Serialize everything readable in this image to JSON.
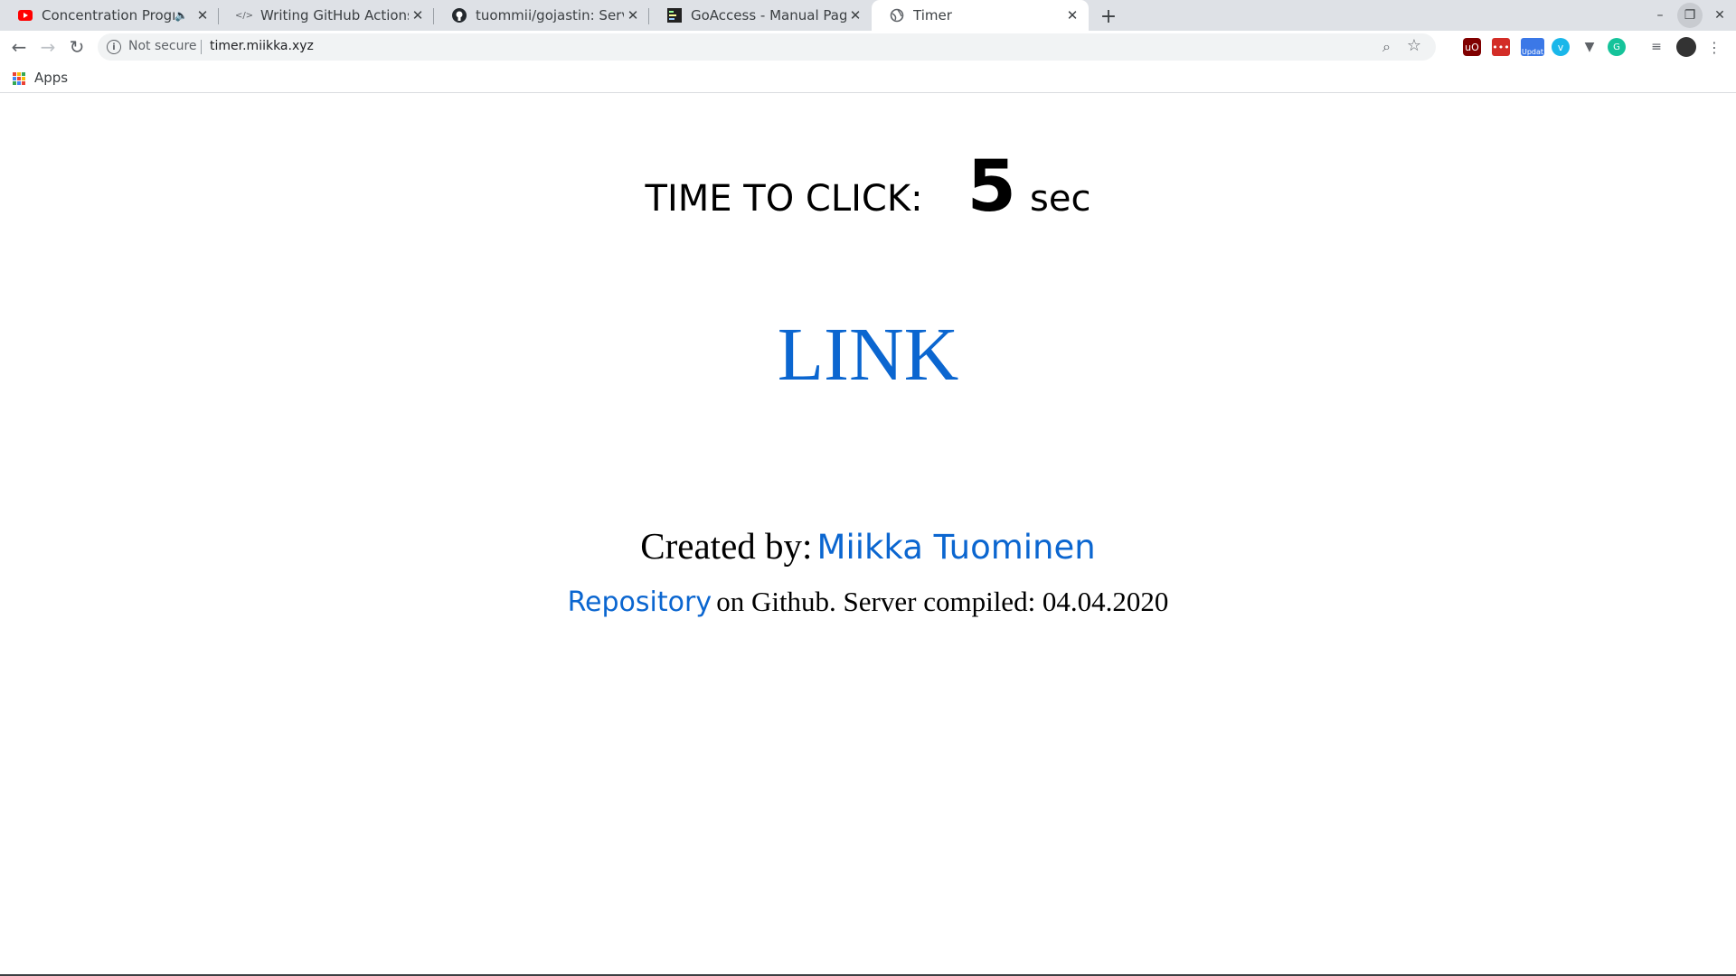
{
  "browser": {
    "tabs": [
      {
        "title": "Concentration Program - YouTube",
        "active": false,
        "favicon": "youtube-icon",
        "audible": true
      },
      {
        "title": "Writing GitHub Actions in Go",
        "active": false,
        "favicon": "code-icon",
        "audible": false
      },
      {
        "title": "tuommii/gojastin: Server",
        "active": false,
        "favicon": "github-icon",
        "audible": false
      },
      {
        "title": "GoAccess - Manual Page",
        "active": false,
        "favicon": "terminal-icon",
        "audible": false
      },
      {
        "title": "Timer",
        "active": true,
        "favicon": "globe-icon",
        "audible": false
      }
    ],
    "omnibox": {
      "security_label": "Not secure",
      "url": "timer.miikka.xyz"
    },
    "bookmarks": {
      "apps_label": "Apps"
    },
    "extensions": {
      "update_badge": "Updat"
    }
  },
  "page": {
    "timer_label": "TIME TO CLICK:",
    "timer_value": "5",
    "timer_unit": "sec",
    "main_link": "LINK",
    "created_prefix": "Created by:",
    "author_name": "Miikka Tuominen",
    "repo_link": "Repository",
    "repo_suffix": "on Github. Server compiled: 04.04.2020"
  },
  "colors": {
    "link": "#0b66d0",
    "text": "#000000",
    "tabstrip": "#dee1e6"
  }
}
